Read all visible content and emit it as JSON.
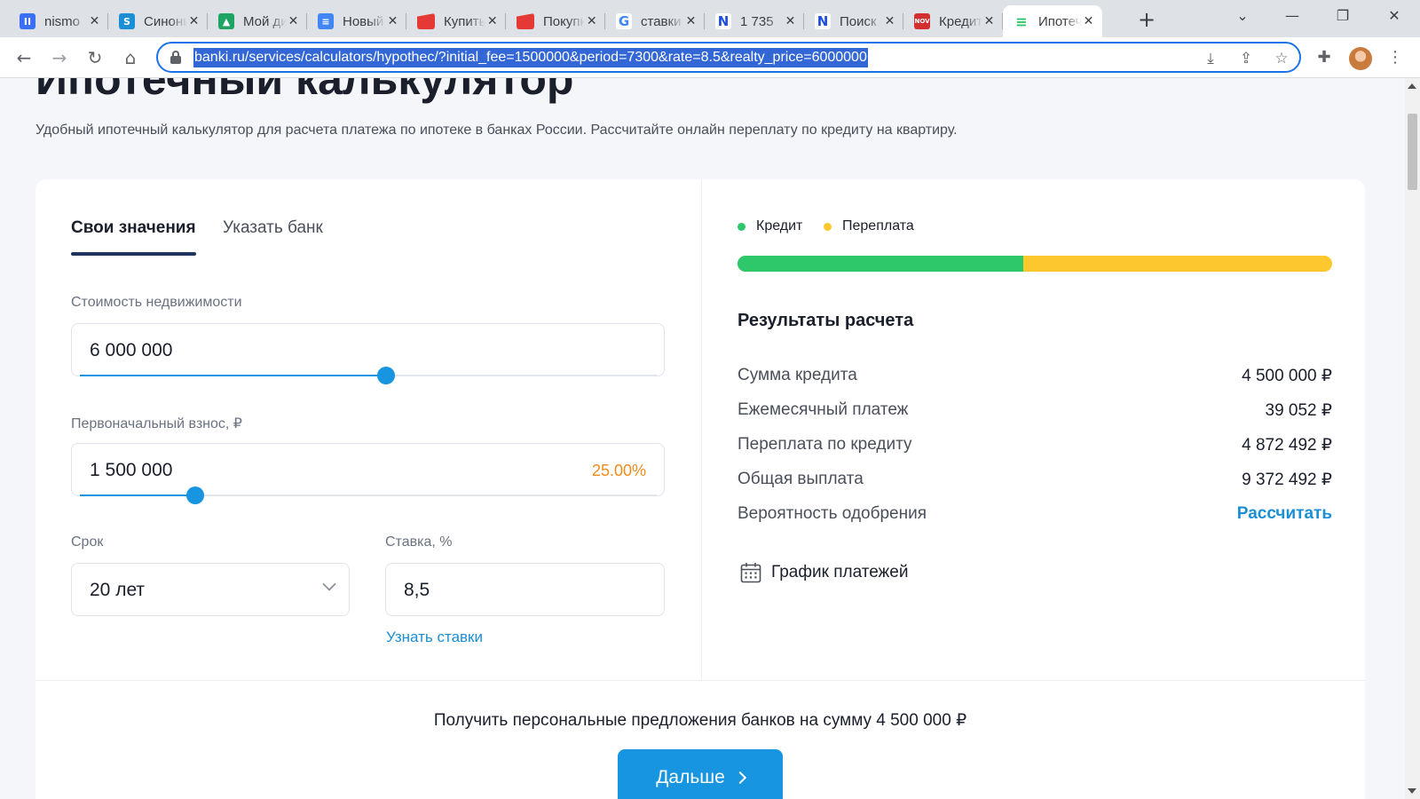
{
  "browser": {
    "tabs": [
      {
        "label": "nismo",
        "favicon": "purple-pause-favicon",
        "color": "#3b6ff6",
        "glyph": "II"
      },
      {
        "label": "Синонимы",
        "favicon": "s-favicon",
        "color": "#1a8fd6",
        "glyph": "S"
      },
      {
        "label": "Мой диск",
        "favicon": "google-drive-favicon",
        "color": "#1fa463",
        "glyph": "▲"
      },
      {
        "label": "Новый документ",
        "favicon": "google-docs-favicon",
        "color": "#4285f4",
        "glyph": "≡"
      },
      {
        "label": "Купить",
        "favicon": "red-flag-favicon",
        "color": "#e53935",
        "glyph": ""
      },
      {
        "label": "Покупка",
        "favicon": "red-flag-favicon",
        "color": "#e53935",
        "glyph": ""
      },
      {
        "label": "ставки",
        "favicon": "google-favicon",
        "color": "#ffffff",
        "glyph": "G"
      },
      {
        "label": "1 735",
        "favicon": "blue-n-favicon",
        "color": "#ffffff",
        "glyph": "N"
      },
      {
        "label": "Поиск",
        "favicon": "blue-n-favicon",
        "color": "#ffffff",
        "glyph": "N"
      },
      {
        "label": "Кредит",
        "favicon": "nov-favicon",
        "color": "#d32f2f",
        "glyph": "NOV"
      },
      {
        "label": "Ипотечный",
        "favicon": "banki-favicon",
        "color": "#ffffff",
        "glyph": "≡",
        "active": true
      }
    ],
    "url": "banki.ru/services/calculators/hypothec/?initial_fee=1500000&period=7300&rate=8.5&realty_price=6000000"
  },
  "page": {
    "title": "Ипотечный калькулятор",
    "subtitle": "Удобный ипотечный калькулятор для расчета платежа по ипотеке в банках России. Рассчитайте онлайн переплату по кредиту на квартиру."
  },
  "calculator": {
    "tabs": [
      "Свои значения",
      "Указать банк"
    ],
    "property_price": {
      "label": "Стоимость недвижимости",
      "value": "6 000 000",
      "slider_fraction": 0.53
    },
    "initial_fee": {
      "label": "Первоначальный взнос, ₽",
      "value": "1 500 000",
      "percent": "25.00%",
      "slider_fraction": 0.2
    },
    "term": {
      "label": "Срок",
      "value": "20 лет"
    },
    "rate": {
      "label": "Ставка, %",
      "value": "8,5",
      "link": "Узнать ставки"
    }
  },
  "results": {
    "legend": [
      {
        "label": "Кредит",
        "color": "#2ec76a"
      },
      {
        "label": "Переплата",
        "color": "#fcc82e"
      }
    ],
    "credit_fraction": 0.48,
    "title": "Результаты расчета",
    "rows": [
      {
        "label": "Сумма кредита",
        "value": "4 500 000 ₽"
      },
      {
        "label": "Ежемесячный платеж",
        "value": "39 052 ₽"
      },
      {
        "label": "Переплата по кредиту",
        "value": "4 872 492 ₽"
      },
      {
        "label": "Общая выплата",
        "value": "9 372 492 ₽"
      },
      {
        "label": "Вероятность одобрения",
        "value": "Рассчитать"
      }
    ],
    "schedule_label": "График платежей"
  },
  "offer": {
    "text": "Получить персональные предложения банков на сумму 4 500 000 ₽",
    "button": "Дальше"
  }
}
